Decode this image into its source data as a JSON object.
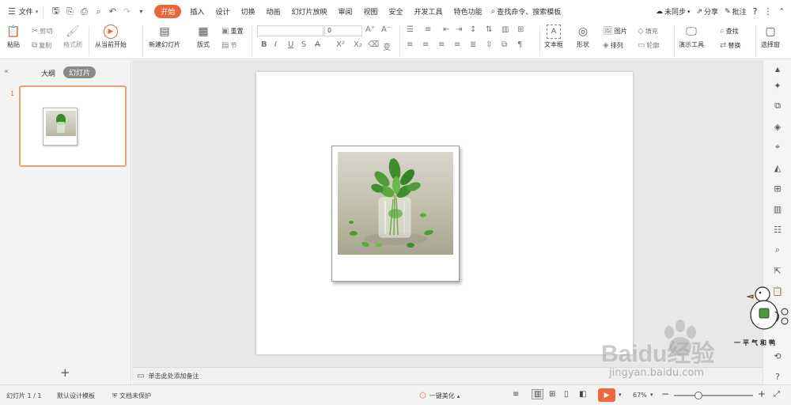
{
  "menubar": {
    "file": "文件",
    "tabs": [
      "开始",
      "插入",
      "设计",
      "切换",
      "动画",
      "幻灯片放映",
      "审阅",
      "视图",
      "安全",
      "开发工具",
      "特色功能"
    ],
    "search_placeholder": "查找命令、搜索模板",
    "sync": "未同步",
    "share": "分享",
    "comment": "批注"
  },
  "ribbon": {
    "paste": "粘贴",
    "cut": "剪切",
    "copy": "复制",
    "format_painter": "格式刷",
    "from_current": "从当前开始",
    "new_slide": "新建幻灯片",
    "layout": "版式",
    "reset": "重置",
    "section": "节",
    "font_size": "0",
    "textbox": "文本框",
    "shape": "形状",
    "picture": "图片",
    "fill": "填充",
    "arrange": "排列",
    "outline": "轮廓",
    "present_tools": "演示工具",
    "find": "查找",
    "replace": "替换",
    "select_pane": "选择窗"
  },
  "left_panel": {
    "tab_outline": "大纲",
    "tab_slides": "幻灯片",
    "slide_number": "1",
    "add": "+"
  },
  "notes": {
    "placeholder": "单击此处添加备注"
  },
  "statusbar": {
    "slide_info": "幻灯片 1 / 1",
    "template": "默认设计模板",
    "protection": "文档未保护",
    "beautify": "一键美化",
    "zoom": "67%"
  },
  "watermark": {
    "brand": "Baidu经验",
    "url": "jingyan.baidu.com",
    "handwriting": "一平气和鸭"
  },
  "colors": {
    "accent": "#e8683c",
    "play": "#f0663e",
    "slide_border": "#e8a070"
  }
}
